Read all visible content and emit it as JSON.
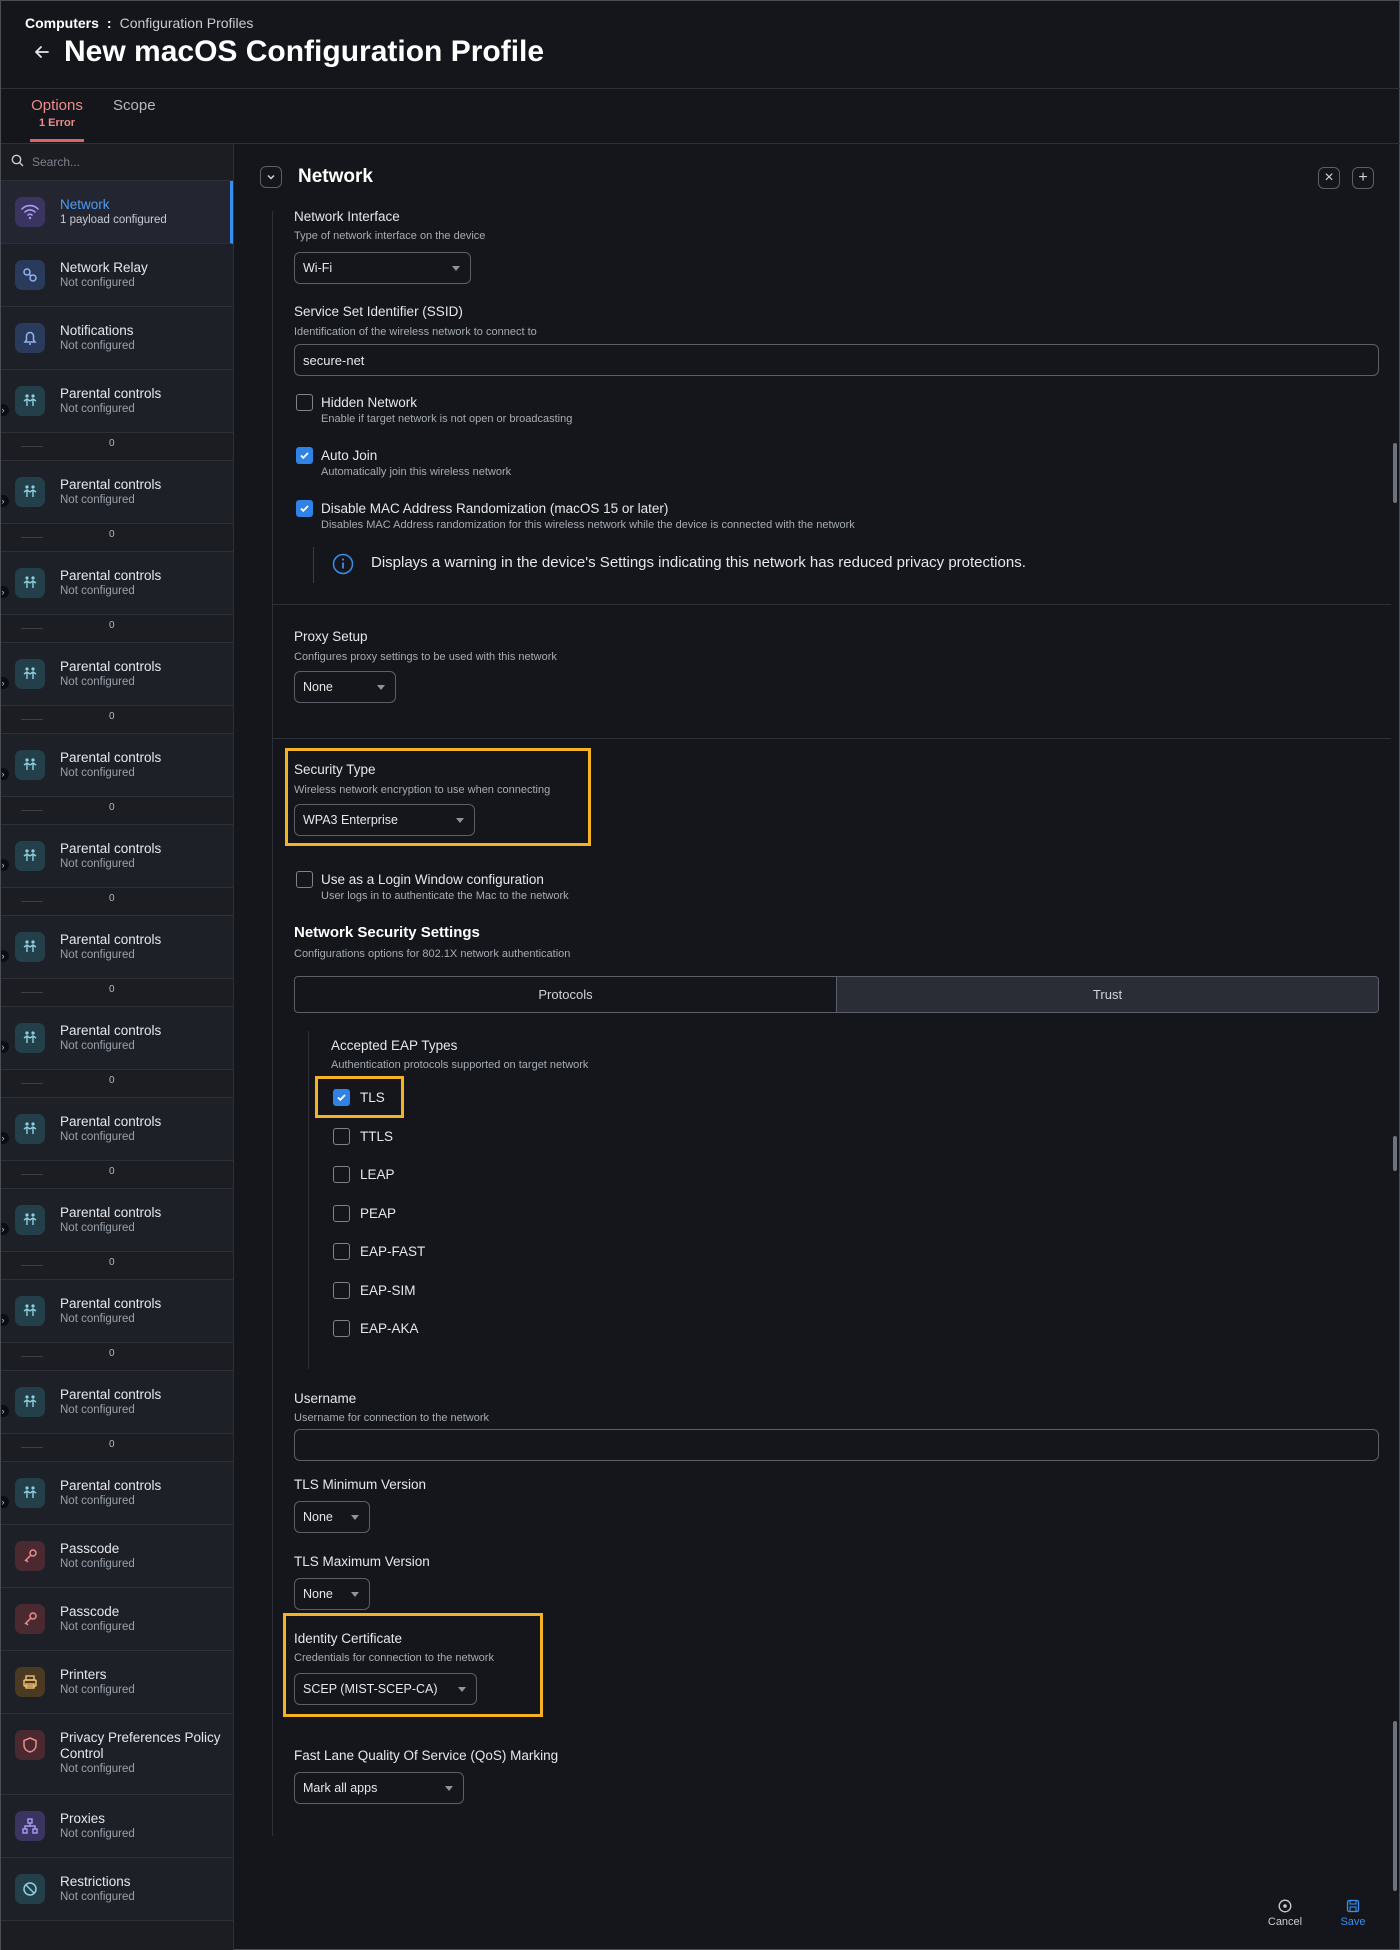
{
  "breadcrumb": {
    "root": "Computers",
    "separator": ":",
    "current": "Configuration Profiles"
  },
  "page_title": "New macOS Configuration Profile",
  "tabs": [
    {
      "label": "Options",
      "badge": "1 Error"
    },
    {
      "label": "Scope"
    }
  ],
  "colors": {
    "accent": "#3a8ef0",
    "error": "#e06363",
    "highlight": "#f5b324"
  },
  "sidebar": {
    "search_placeholder": "Search...",
    "items": [
      {
        "name": "Network",
        "status": "1 payload configured",
        "icon": "wifi-icon"
      },
      {
        "name": "Network Relay",
        "status": "Not configured",
        "icon": "relay-icon"
      },
      {
        "name": "Notifications",
        "status": "Not configured",
        "icon": "bell-icon"
      },
      {
        "name": "Parental controls",
        "status": "Not configured",
        "icon": "family-icon",
        "sub": "0"
      },
      {
        "name": "Parental controls",
        "status": "Not configured",
        "icon": "family-icon",
        "sub": "0"
      },
      {
        "name": "Parental controls",
        "status": "Not configured",
        "icon": "family-icon",
        "sub": "0"
      },
      {
        "name": "Parental controls",
        "status": "Not configured",
        "icon": "family-icon",
        "sub": "0"
      },
      {
        "name": "Parental controls",
        "status": "Not configured",
        "icon": "family-icon",
        "sub": "0"
      },
      {
        "name": "Parental controls",
        "status": "Not configured",
        "icon": "family-icon",
        "sub": "0"
      },
      {
        "name": "Parental controls",
        "status": "Not configured",
        "icon": "family-icon",
        "sub": "0"
      },
      {
        "name": "Parental controls",
        "status": "Not configured",
        "icon": "family-icon",
        "sub": "0"
      },
      {
        "name": "Parental controls",
        "status": "Not configured",
        "icon": "family-icon",
        "sub": "0"
      },
      {
        "name": "Parental controls",
        "status": "Not configured",
        "icon": "family-icon",
        "sub": "0"
      },
      {
        "name": "Parental controls",
        "status": "Not configured",
        "icon": "family-icon",
        "sub": "0"
      },
      {
        "name": "Parental controls",
        "status": "Not configured",
        "icon": "family-icon",
        "sub": "0"
      },
      {
        "name": "Parental controls",
        "status": "Not configured",
        "icon": "family-icon"
      },
      {
        "name": "Passcode",
        "status": "Not configured",
        "icon": "key-icon"
      },
      {
        "name": "Passcode",
        "status": "Not configured",
        "icon": "key-icon"
      },
      {
        "name": "Printers",
        "status": "Not configured",
        "icon": "printer-icon"
      },
      {
        "name": "Privacy Preferences Policy Control",
        "status": "Not configured",
        "icon": "shield-icon"
      },
      {
        "name": "Proxies",
        "status": "Not configured",
        "icon": "proxy-icon"
      },
      {
        "name": "Restrictions",
        "status": "Not configured",
        "icon": "ban-icon"
      }
    ]
  },
  "section": {
    "title": "Network"
  },
  "form": {
    "network_interface": {
      "label": "Network Interface",
      "desc": "Type of network interface on the device",
      "value": "Wi-Fi"
    },
    "ssid": {
      "label": "Service Set Identifier (SSID)",
      "desc": "Identification of the wireless network to connect to",
      "value": "secure-net"
    },
    "hidden_network": {
      "label": "Hidden Network",
      "desc": "Enable if target network is not open or broadcasting",
      "checked": false
    },
    "auto_join": {
      "label": "Auto Join",
      "desc": "Automatically join this wireless network",
      "checked": true
    },
    "disable_mac": {
      "label": "Disable MAC Address Randomization (macOS 15 or later)",
      "desc": "Disables MAC Address randomization for this wireless network while the device is connected with the network",
      "checked": true
    },
    "mac_warning": "Displays a warning in the device's Settings indicating this network has reduced privacy protections.",
    "proxy_setup": {
      "label": "Proxy Setup",
      "desc": "Configures proxy settings to be used with this network",
      "value": "None"
    },
    "security_type": {
      "label": "Security Type",
      "desc": "Wireless network encryption to use when connecting",
      "value": "WPA3 Enterprise"
    },
    "login_window": {
      "label": "Use as a Login Window configuration",
      "desc": "User logs in to authenticate the Mac to the network",
      "checked": false
    },
    "nss": {
      "title": "Network Security Settings",
      "desc": "Configurations options for 802.1X network authentication",
      "tabs": [
        "Protocols",
        "Trust"
      ]
    },
    "eap": {
      "label": "Accepted EAP Types",
      "desc": "Authentication protocols supported on target network",
      "types": [
        {
          "label": "TLS",
          "checked": true
        },
        {
          "label": "TTLS",
          "checked": false
        },
        {
          "label": "LEAP",
          "checked": false
        },
        {
          "label": "PEAP",
          "checked": false
        },
        {
          "label": "EAP-FAST",
          "checked": false
        },
        {
          "label": "EAP-SIM",
          "checked": false
        },
        {
          "label": "EAP-AKA",
          "checked": false
        }
      ]
    },
    "username": {
      "label": "Username",
      "desc": "Username for connection to the network",
      "value": ""
    },
    "tls_min": {
      "label": "TLS Minimum Version",
      "value": "None"
    },
    "tls_max": {
      "label": "TLS Maximum Version",
      "value": "None"
    },
    "identity_cert": {
      "label": "Identity Certificate",
      "desc": "Credentials for connection to the network",
      "value": "SCEP (MIST-SCEP-CA)"
    },
    "qos": {
      "label": "Fast Lane Quality Of Service (QoS) Marking",
      "value": "Mark all apps"
    }
  },
  "footer": {
    "cancel": "Cancel",
    "save": "Save"
  }
}
